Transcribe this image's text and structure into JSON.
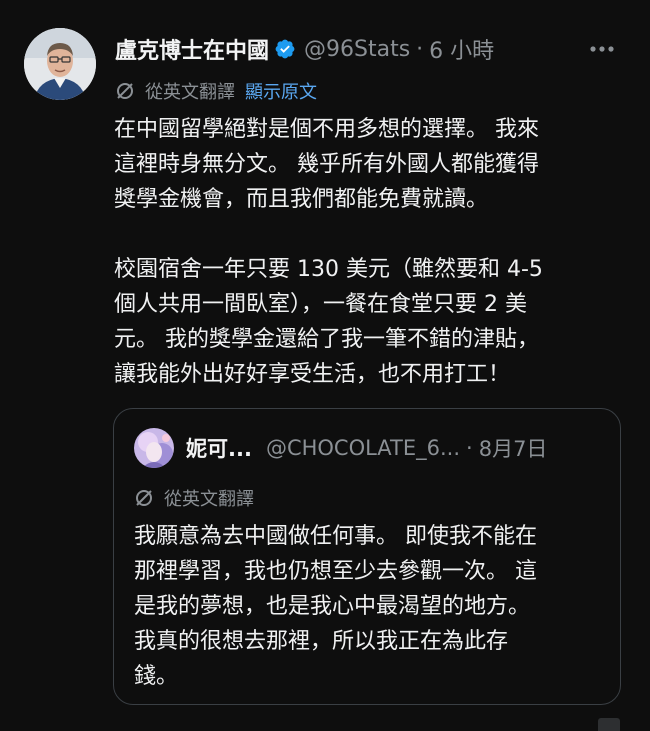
{
  "post": {
    "author_name": "盧克博士在中國",
    "handle": "@96Stats",
    "separator": "·",
    "time": "6 小時",
    "translate_label": "從英文翻譯",
    "show_original": "顯示原文",
    "paragraphs": [
      "在中國留學絕對是個不用多想的選擇。 我來\n這裡時身無分文。 幾乎所有外國人都能獲得\n獎學金機會，而且我們都能免費就讀。",
      "校園宿舍一年只要 130 美元（雖然要和 4-5\n個人共用一間臥室），一餐在食堂只要 2 美\n元。 我的獎學金還給了我一筆不錯的津貼，\n讓我能外出好好享受生活，也不用打工！"
    ]
  },
  "quoted": {
    "author_name": "妮可...",
    "handle": "@CHOCOLATE_6...",
    "separator": "·",
    "time": "8月7日",
    "translate_label": "從英文翻譯",
    "text": "我願意為去中國做任何事。 即使我不能在\n那裡學習，我也仍想至少去參觀一次。 這\n是我的夢想，也是我心中最渴望的地方。\n我真的很想去那裡，所以我正在為此存\n錢。"
  },
  "icons": {
    "verified": "verified-badge-icon",
    "more": "more-options-icon",
    "translate": "translate-icon"
  },
  "colors": {
    "background": "#0e0e0e",
    "text": "#f0f1f2",
    "muted": "#8b9095",
    "link": "#5aa7f0",
    "verified": "#1d9bf0",
    "border": "#3a3f44"
  }
}
